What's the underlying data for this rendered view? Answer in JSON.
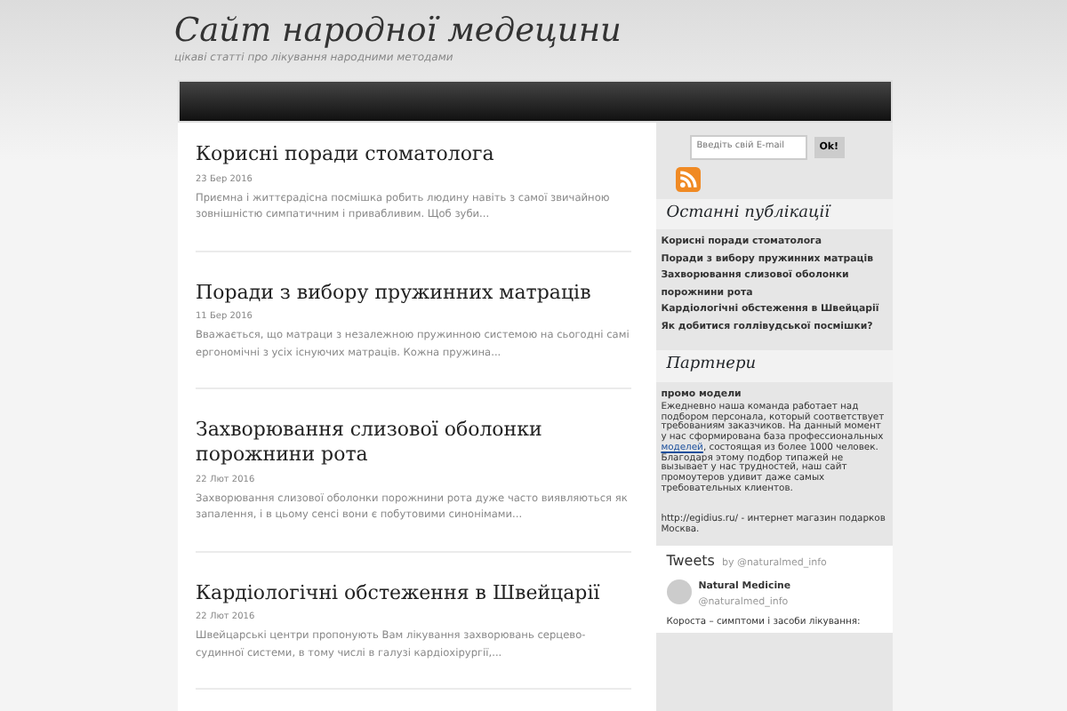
{
  "site": {
    "title": "Сайт народної медецини",
    "tagline": "цікаві статті про лікування народними методами"
  },
  "posts": [
    {
      "title": "Корисні поради стоматолога",
      "date": "23 Бер 2016",
      "excerpt": "Приємна і життєрадісна посмішка робить людину навіть з самої звичайною зовнішністю симпатичним і привабливим. Щоб зуби..."
    },
    {
      "title": "Поради з вибору пружинних матраців",
      "date": "11 Бер 2016",
      "excerpt": "Вважається, що матраци з незалежною пружинною системою на сьогодні самі ергономічні з усіх існуючих матраців. Кожна пружина..."
    },
    {
      "title": "Захворювання слизової оболонки порожнини рота",
      "date": "22 Лют 2016",
      "excerpt": "Захворювання слизової оболонки порожнини рота дуже часто виявляються як запалення, і в цьому сенсі вони є побутовими синонімами..."
    },
    {
      "title": "Кардіологічні обстеження в Швейцарії",
      "date": "22 Лют 2016",
      "excerpt": "Швейцарські центри пропонують Вам лікування захворювань серцево-судинної системи, в тому числі в галузі кардіохірургії,..."
    }
  ],
  "subscribe": {
    "placeholder": "Введіть свій E-mail",
    "button": "Ok!"
  },
  "recent": {
    "heading": "Останні публікації",
    "items": [
      "Корисні поради стоматолога",
      "Поради з вибору пружинних матраців",
      "Захворювання слизової оболонки порожнини рота",
      "Кардіологічні обстеження в Швейцарії",
      "Як добитися голлівудської посмішки?"
    ]
  },
  "partners": {
    "heading": "Партнери",
    "subheading": "промо модели",
    "text_before": "Ежедневно наша команда работает над подбором персонала, который соответствует требованиям заказчиков. На данный момент у нас сформирована база профессиональных",
    "link": "моделей",
    "text_after": ", состоящая из более 1000 человек. Благодаря этому подбор типажей не вызывает у нас трудностей, наш сайт промоутеров удивит даже самых требовательных клиентов.",
    "footer": "http://egidius.ru/ - интернет магазин подарков Москва."
  },
  "tweets": {
    "heading": "Tweets",
    "by": "by @naturalmed_info",
    "author": "Natural Medicine",
    "handle": "@naturalmed_info",
    "text": "Короста – симптоми і засоби лікування:"
  }
}
